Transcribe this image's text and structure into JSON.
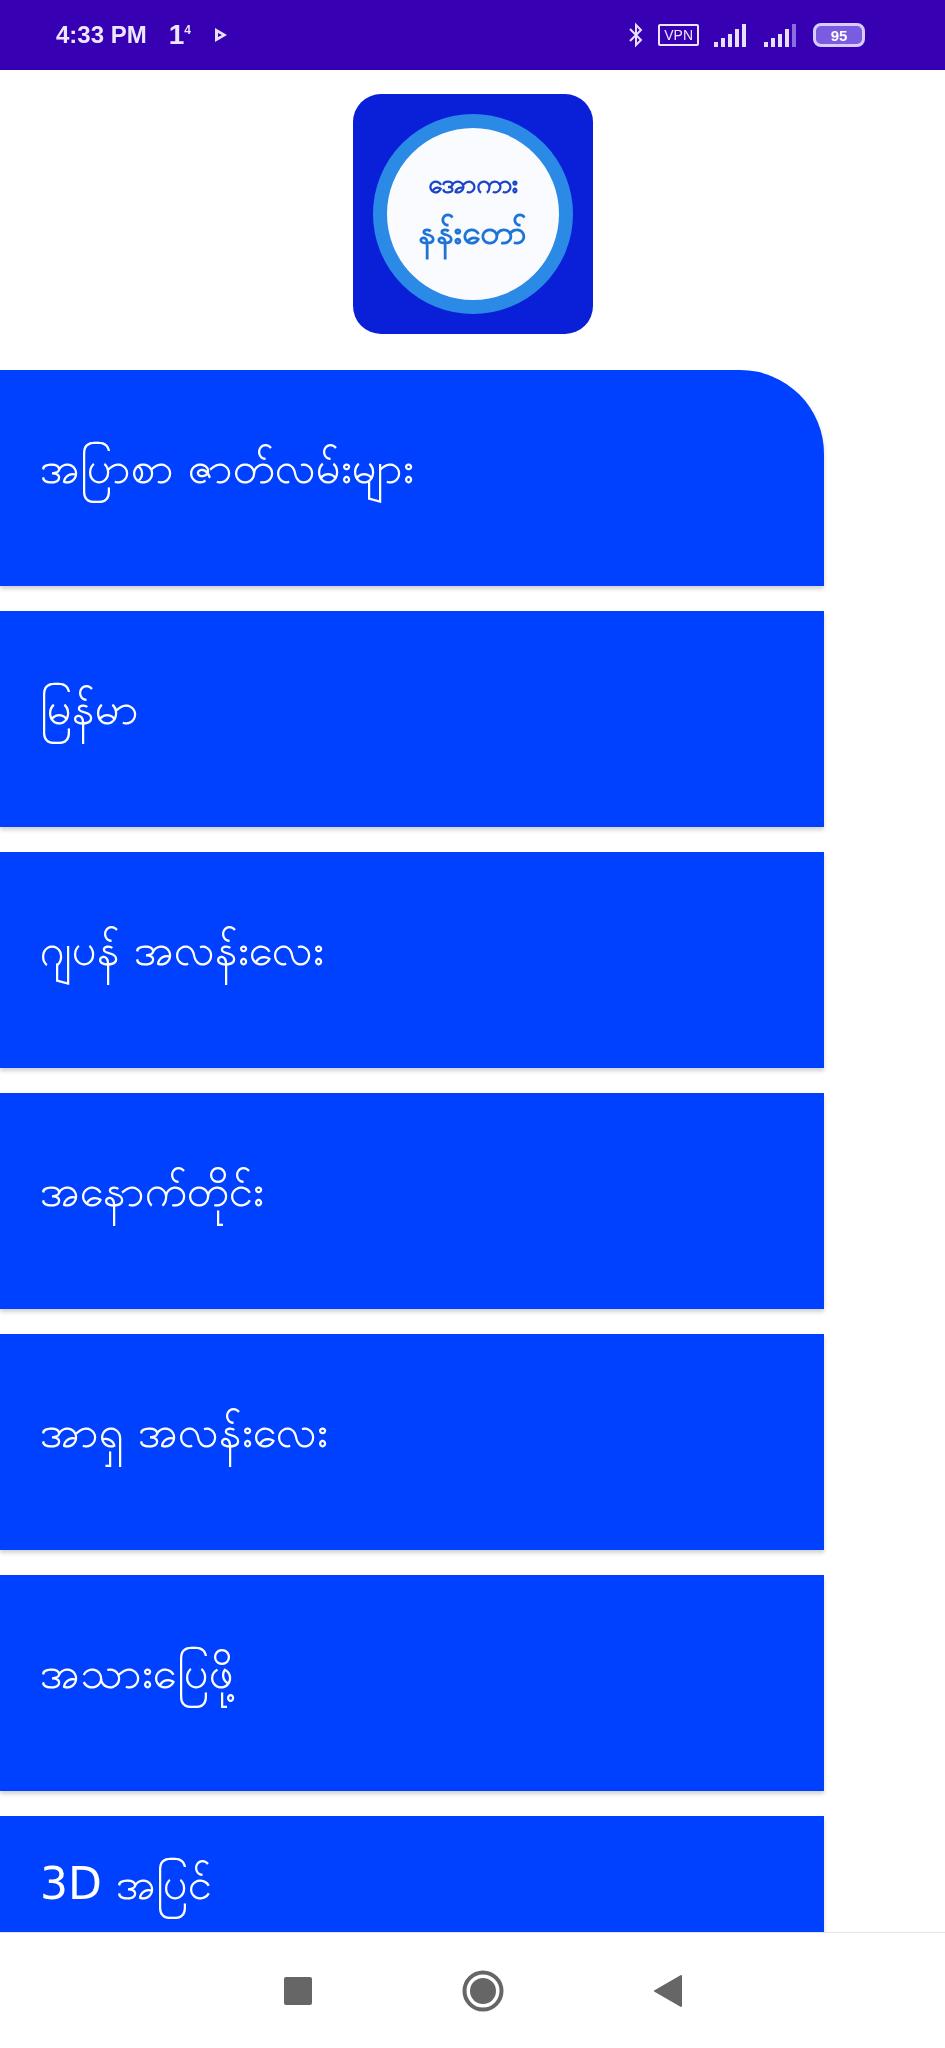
{
  "status_bar": {
    "time": "4:33 PM",
    "notification": "1$^{4}$",
    "vpn": "VPN",
    "battery": "95"
  },
  "logo": {
    "line_1": "အောကား",
    "line_2": "နန်းတော်"
  },
  "menu": [
    {
      "label": "အပြာစာ ဇာတ်လမ်းများ"
    },
    {
      "label": "မြန်မာ"
    },
    {
      "label": "ဂျပန် အလန်းလေး"
    },
    {
      "label": "အနောက်တိုင်း"
    },
    {
      "label": "အာရှ အလန်းလေး"
    },
    {
      "label": "အသားပြေဖို့"
    },
    {
      "label": "3D အပြင်"
    }
  ]
}
